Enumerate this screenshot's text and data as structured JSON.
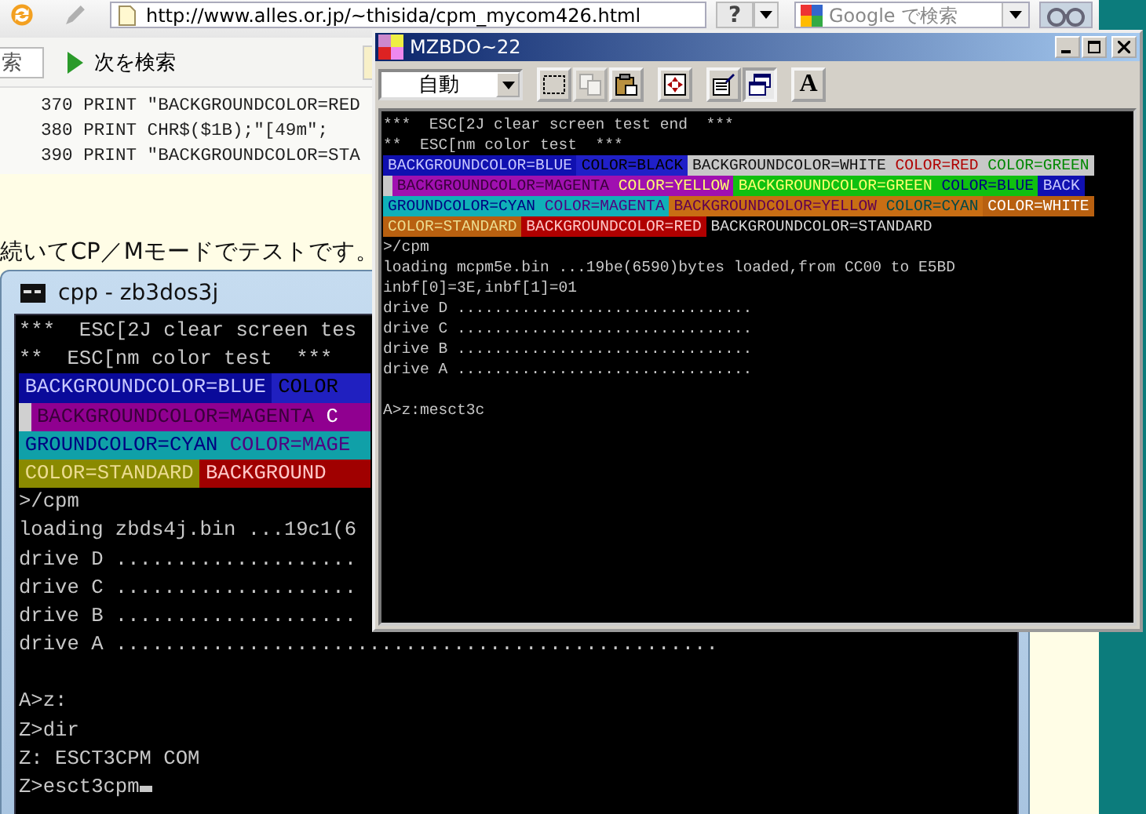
{
  "browser": {
    "url": "http://www.alles.or.jp/~thisida/cpm_mycom426.html",
    "help_button": "?",
    "search_placeholder": "Google で検索",
    "find_field_value": "索",
    "find_next_button": "次を検索"
  },
  "page": {
    "code_lines": [
      "370 PRINT \"BACKGROUNDCOLOR=RED",
      "380 PRINT CHR$($1B);\"[49m\";",
      "390 PRINT \"BACKGROUNDCOLOR=STA"
    ],
    "paragraph": "続いてCP／Mモードでテストです。"
  },
  "console_window": {
    "title": "cpp - zb3dos3j",
    "lines": [
      {
        "kind": "text",
        "text": "***  ESC[2J clear screen tes"
      },
      {
        "kind": "text",
        "text": "**  ESC[nm color test  ***"
      },
      {
        "kind": "colored",
        "segments": [
          {
            "kind": "pale",
            "text": "BACKGROUNDCOLOR=BLUE",
            "color": "#0a0a9a"
          },
          {
            "kind": "black",
            "text": "COLOR",
            "color": "#2020c0"
          }
        ]
      },
      {
        "kind": "colored",
        "segments": [
          {
            "kind": "block",
            "color": "#d0d0d0"
          },
          {
            "kind": "plum",
            "text": "BACKGROUNDCOLOR=MAGENTA",
            "color": "#900090"
          },
          {
            "kind": "white",
            "text": "C",
            "color": "#900090"
          }
        ]
      },
      {
        "kind": "colored",
        "segments": [
          {
            "kind": "navy",
            "text": "GROUNDCOLOR=CYAN",
            "color": "#10a0a8"
          },
          {
            "kind": "violet",
            "text": "COLOR=MAGE",
            "color": "#10a0a8"
          }
        ]
      },
      {
        "kind": "colored",
        "segments": [
          {
            "kind": "sand",
            "text": "COLOR=STANDARD",
            "color": "#8a8a00"
          },
          {
            "kind": "pink",
            "text": "BACKGROUND",
            "color": "#a00000"
          }
        ]
      },
      {
        "kind": "text",
        "text": ">/cpm"
      },
      {
        "kind": "text",
        "text": "loading zbds4j.bin ...19c1(6"
      },
      {
        "kind": "text",
        "text": "drive D ...................."
      },
      {
        "kind": "text",
        "text": "drive C ...................."
      },
      {
        "kind": "text",
        "text": "drive B ...................."
      },
      {
        "kind": "text",
        "text": "drive A .................................................."
      },
      {
        "kind": "blank"
      },
      {
        "kind": "text",
        "text": "A>z:"
      },
      {
        "kind": "text",
        "text": "Z>dir"
      },
      {
        "kind": "text",
        "text": "Z: ESCT3CPM COM"
      },
      {
        "kind": "text",
        "text": "Z>esct3cpm",
        "cursor": true
      }
    ]
  },
  "mzbdo_window": {
    "title": "MZBDO~22",
    "mode_dropdown": "自動",
    "toolbar_buttons": [
      {
        "kind": "select",
        "disabled": false,
        "pressed": false
      },
      {
        "kind": "copy",
        "disabled": true,
        "pressed": false
      },
      {
        "kind": "paste",
        "disabled": false,
        "pressed": false
      },
      {
        "kind": "fullscreen",
        "disabled": false,
        "pressed": false
      },
      {
        "kind": "properties",
        "disabled": false,
        "pressed": false
      },
      {
        "kind": "background",
        "disabled": false,
        "pressed": true
      },
      {
        "kind": "font",
        "label": "A",
        "disabled": false,
        "pressed": false
      }
    ],
    "lines": [
      {
        "kind": "text",
        "text": "***  ESC[2J clear screen test end  ***"
      },
      {
        "kind": "text",
        "text": "**  ESC[nm color test  ***"
      },
      {
        "kind": "colored",
        "segments": [
          {
            "kind": "pale",
            "text": "BACKGROUNDCOLOR=BLUE",
            "color": "#1010b0"
          },
          {
            "kind": "black",
            "text": "COLOR=BLACK",
            "color": "#2020c8"
          },
          {
            "kind": "dark",
            "text": "BACKGROUNDCOLOR=WHITE",
            "color": "#c8c8c8"
          },
          {
            "kind": "red",
            "text": "COLOR=RED",
            "color": "#c8c8c8"
          },
          {
            "kind": "green",
            "text": "COLOR=GREEN",
            "color": "#c8c8c8"
          }
        ]
      },
      {
        "kind": "colored",
        "segments": [
          {
            "kind": "block",
            "color": "#c8c8c8"
          },
          {
            "kind": "plum",
            "text": "BACKGROUNDCOLOR=MAGENTA",
            "color": "#a010b0"
          },
          {
            "kind": "yellow",
            "text": "COLOR=YELLOW",
            "color": "#a010b0"
          },
          {
            "kind": "yellow",
            "text": "BACKGROUNDCOLOR=GREEN",
            "color": "#10c010"
          },
          {
            "kind": "navy",
            "text": "COLOR=BLUE",
            "color": "#10c010"
          },
          {
            "kind": "pale",
            "text": "BACK",
            "color": "#1010b0"
          }
        ]
      },
      {
        "kind": "colored",
        "segments": [
          {
            "kind": "navy",
            "text": "GROUNDCOLOR=CYAN",
            "color": "#10b0b8"
          },
          {
            "kind": "violet",
            "text": "COLOR=MAGENTA",
            "color": "#10b0b8"
          },
          {
            "kind": "wine",
            "text": "BACKGROUNDCOLOR=YELLOW",
            "color": "#c86e14"
          },
          {
            "kind": "teal",
            "text": "COLOR=CYAN",
            "color": "#c86e14"
          },
          {
            "kind": "white",
            "text": "COLOR=WHITE",
            "color": "#b86010"
          }
        ]
      },
      {
        "kind": "colored",
        "segments": [
          {
            "kind": "sand",
            "text": "COLOR=STANDARD",
            "color": "#b86010"
          },
          {
            "kind": "pink",
            "text": "BACKGROUNDCOLOR=RED",
            "color": "#b00000"
          },
          {
            "kind": "gray",
            "text": "BACKGROUNDCOLOR=STANDARD",
            "color": "#000000"
          }
        ]
      },
      {
        "kind": "text",
        "text": ">/cpm"
      },
      {
        "kind": "text",
        "text": "loading mcpm5e.bin ...19be(6590)bytes loaded,from CC00 to E5BD"
      },
      {
        "kind": "text",
        "text": "inbf[0]=3E,inbf[1]=01"
      },
      {
        "kind": "text",
        "text": "drive D ................................"
      },
      {
        "kind": "text",
        "text": "drive C ................................"
      },
      {
        "kind": "text",
        "text": "drive B ................................"
      },
      {
        "kind": "text",
        "text": "drive A ................................"
      },
      {
        "kind": "blank"
      },
      {
        "kind": "text",
        "text": "A>z:mesct3c"
      }
    ]
  }
}
